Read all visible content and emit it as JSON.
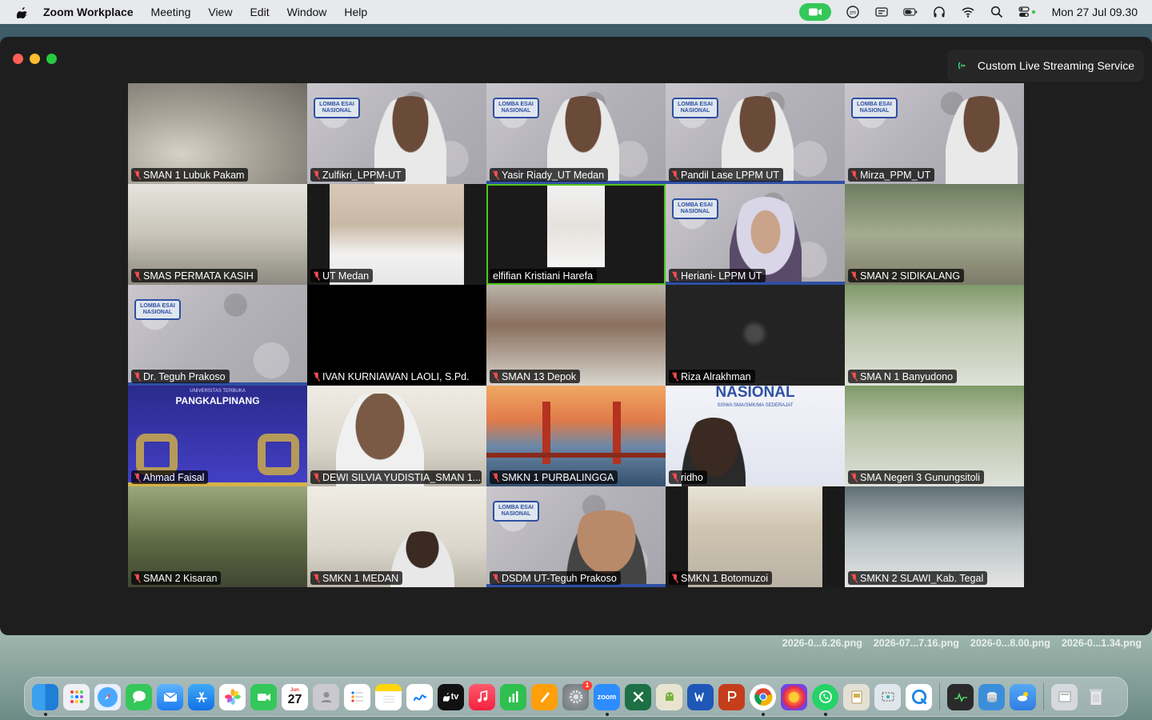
{
  "menubar": {
    "app_name": "Zoom Workplace",
    "menus": [
      "Meeting",
      "View",
      "Edit",
      "Window",
      "Help"
    ],
    "clock": "Mon 27 Jul  09.30"
  },
  "window": {
    "streaming_label": "Custom Live Streaming Service"
  },
  "tile_text": {
    "lomba_badge": "LOMBA ESAI NASIONAL",
    "pangkal_sub": "UNIVERSITAS TERBUKA",
    "pangkal_title": "PANGKALPINANG",
    "nasional_title": "NASIONAL",
    "nasional_sub": "SISWA SMA/SMK/MA SEDERAJAT"
  },
  "participants": [
    {
      "name": "SMAN 1 Lubuk Pakam"
    },
    {
      "name": "Zulfikri_LPPM-UT"
    },
    {
      "name": "Yasir Riady_UT Medan"
    },
    {
      "name": "Pandil Lase LPPM UT"
    },
    {
      "name": "Mirza_PPM_UT"
    },
    {
      "name": "SMAS PERMATA KASIH"
    },
    {
      "name": "UT Medan"
    },
    {
      "name": "elfifian Kristiani Harefa"
    },
    {
      "name": "Heriani- LPPM UT"
    },
    {
      "name": "SMAN 2 SIDIKALANG"
    },
    {
      "name": "Dr. Teguh Prakoso"
    },
    {
      "name": "IVAN KURNIAWAN LAOLI, S.Pd."
    },
    {
      "name": "SMAN 13 Depok"
    },
    {
      "name": "Riza Alrakhman"
    },
    {
      "name": "SMA N 1 Banyudono"
    },
    {
      "name": "Ahmad Faisal"
    },
    {
      "name": "DEWI SILVIA YUDISTIA_SMAN 1..."
    },
    {
      "name": "SMKN 1 PURBALINGGA"
    },
    {
      "name": "ridho"
    },
    {
      "name": "SMA Negeri 3 Gunungsitoli"
    },
    {
      "name": "SMAN 2 Kisaran"
    },
    {
      "name": "SMKN 1 MEDAN"
    },
    {
      "name": "DSDM UT-Teguh Prakoso"
    },
    {
      "name": "SMKN 1 Botomuzoi"
    },
    {
      "name": "SMKN 2 SLAWI_Kab. Tegal"
    }
  ],
  "desktop_files": [
    "2026-0...6.26.png",
    "2026-07...7.16.png",
    "2026-0...8.00.png",
    "2026-0...1.34.png"
  ],
  "dock": {
    "calendar_month": "Jun",
    "calendar_day": "27",
    "settings_badge": "1",
    "zoom_label": "zoom",
    "tv_label": "tv"
  }
}
